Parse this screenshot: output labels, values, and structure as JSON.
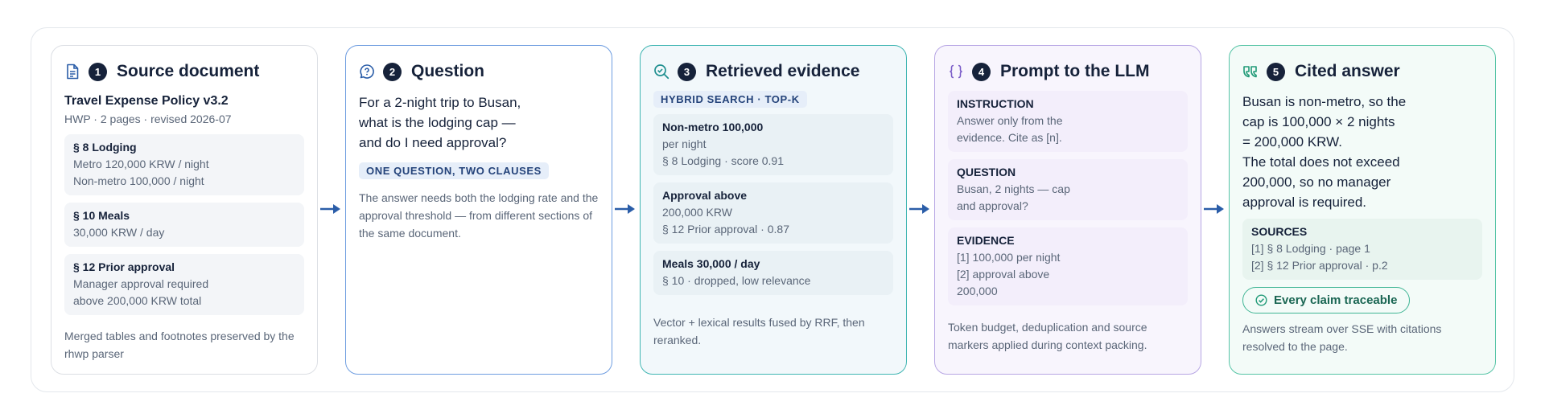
{
  "colors": {
    "ink": "#16223a",
    "muted": "#5a6678",
    "arrow": "#2a5da8",
    "blue": "#6e9de0",
    "teal": "#3fb5b2",
    "purple": "#b7a6e4",
    "green": "#56c4a6"
  },
  "step1": {
    "num": "1",
    "title": "Source document",
    "icon": "document-icon",
    "doc_title": "Travel Expense Policy v3.2",
    "doc_meta": "HWP · 2 pages · revised 2026-07",
    "sections": [
      {
        "title": "§ 8 Lodging",
        "lines": [
          "Metro 120,000 KRW / night",
          "Non-metro 100,000 / night"
        ]
      },
      {
        "title": "§ 10 Meals",
        "lines": [
          "30,000 KRW / day"
        ]
      },
      {
        "title": "§ 12 Prior approval",
        "lines": [
          "Manager approval required",
          "above 200,000 KRW total"
        ]
      }
    ],
    "footer": "Merged tables and footnotes preserved by the rhwp parser"
  },
  "step2": {
    "num": "2",
    "title": "Question",
    "icon": "chat-question-icon",
    "question_lines": [
      "For a 2-night trip to Busan,",
      "what is the lodging cap —",
      "and do I need approval?"
    ],
    "tag": "ONE QUESTION, TWO CLAUSES",
    "note": "The answer needs both the lodging rate and the approval threshold — from different sections of the same document."
  },
  "step3": {
    "num": "3",
    "title": "Retrieved evidence",
    "icon": "search-check-icon",
    "tag": "HYBRID SEARCH · TOP-K",
    "results": [
      {
        "title": "Non-metro 100,000",
        "lines": [
          "per night",
          "§ 8 Lodging · score 0.91"
        ]
      },
      {
        "title": "Approval above",
        "lines": [
          "200,000 KRW",
          "§ 12 Prior approval · 0.87"
        ]
      },
      {
        "title": "Meals 30,000 / day",
        "lines": [
          "§ 10 · dropped, low relevance"
        ]
      }
    ],
    "footer": "Vector + lexical results fused by RRF, then reranked."
  },
  "step4": {
    "num": "4",
    "title": "Prompt to the LLM",
    "icon": "braces-icon",
    "blocks": [
      {
        "title": "INSTRUCTION",
        "lines": [
          "Answer only from the",
          "evidence. Cite as [n]."
        ]
      },
      {
        "title": "QUESTION",
        "lines": [
          "Busan, 2 nights — cap",
          "and approval?"
        ]
      },
      {
        "title": "EVIDENCE",
        "lines": [
          "[1] 100,000 per night",
          "[2] approval above",
          "200,000"
        ]
      }
    ],
    "footer": "Token budget, deduplication and source markers applied during context packing."
  },
  "step5": {
    "num": "5",
    "title": "Cited answer",
    "icon": "quote-icon",
    "answer_lines": [
      "Busan is non-metro, so the",
      "cap is 100,000 × 2 nights",
      "= 200,000 KRW.",
      "The total does not exceed",
      "200,000, so no manager",
      "approval is required."
    ],
    "sources_title": "SOURCES",
    "sources": [
      "[1]  § 8 Lodging · page 1",
      "[2]  § 12 Prior approval · p.2"
    ],
    "badge": "Every claim traceable",
    "footer": "Answers stream over SSE with citations resolved to the page."
  }
}
